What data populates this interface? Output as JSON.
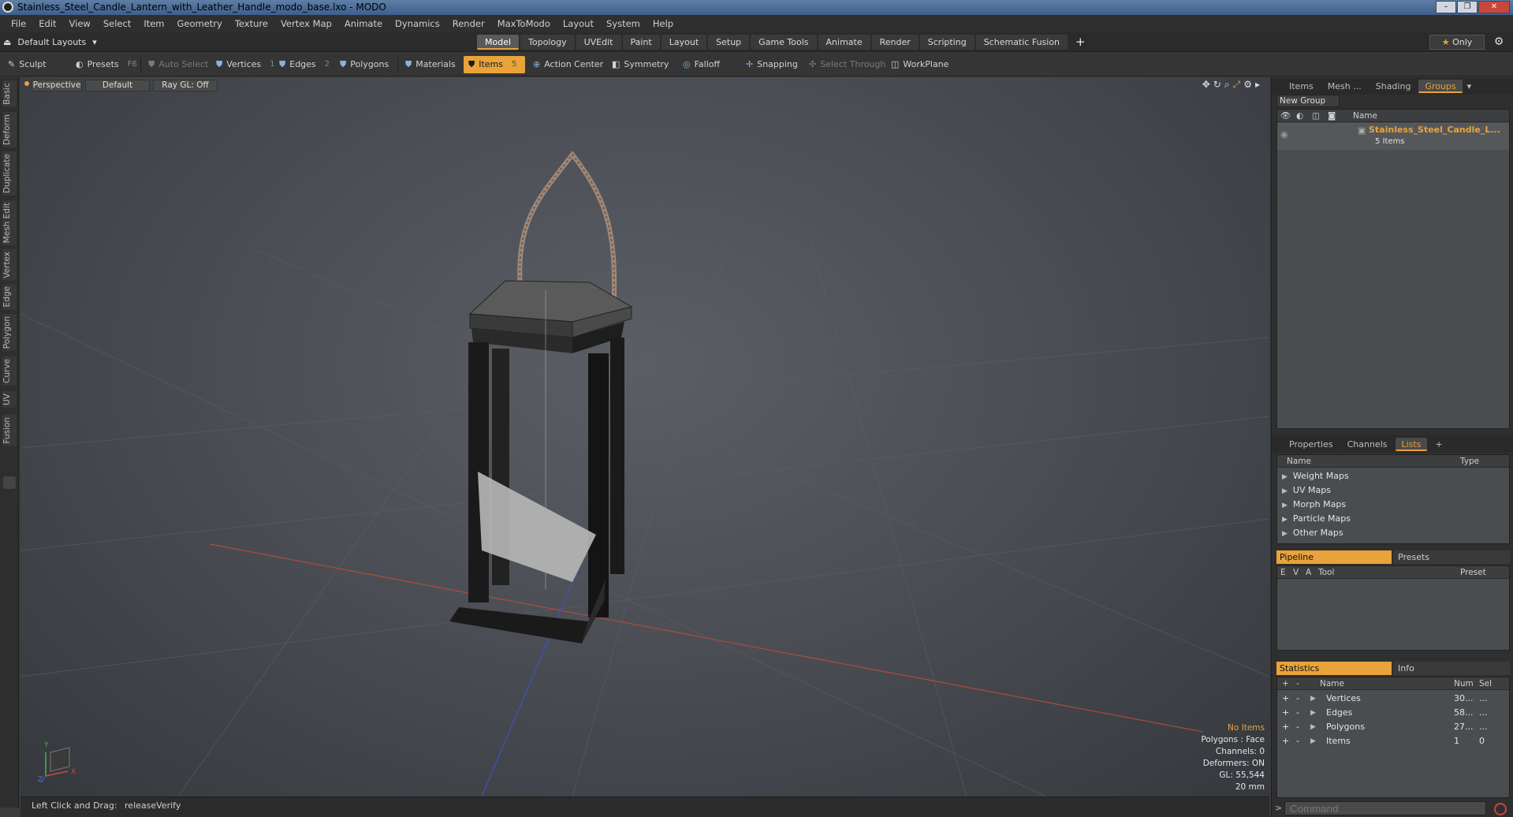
{
  "window": {
    "title": "Stainless_Steel_Candle_Lantern_with_Leather_Handle_modo_base.lxo - MODO",
    "buttons": [
      "–",
      "❐",
      "✕"
    ]
  },
  "menu": [
    "File",
    "Edit",
    "View",
    "Select",
    "Item",
    "Geometry",
    "Texture",
    "Vertex Map",
    "Animate",
    "Dynamics",
    "Render",
    "MaxToModo",
    "Layout",
    "System",
    "Help"
  ],
  "layouts": {
    "selector": "Default Layouts",
    "tabs": [
      "Model",
      "Topology",
      "UVEdit",
      "Paint",
      "Layout",
      "Setup",
      "Game Tools",
      "Animate",
      "Render",
      "Scripting",
      "Schematic Fusion"
    ],
    "active_tab": "Model",
    "plus": "+",
    "only_label": "Only"
  },
  "toolbar": {
    "sculpt": "Sculpt",
    "presets": "Presets",
    "presets_hint": "F6",
    "auto_select": "Auto Select",
    "vertices": "Vertices",
    "vertices_count": "1",
    "edges": "Edges",
    "edges_count": "2",
    "polygons": "Polygons",
    "materials": "Materials",
    "items": "Items",
    "items_count": "5",
    "action_center": "Action Center",
    "symmetry": "Symmetry",
    "falloff": "Falloff",
    "snapping": "Snapping",
    "select_through": "Select Through",
    "workplane": "WorkPlane"
  },
  "left_tabs": [
    "Basic",
    "Deform",
    "Duplicate",
    "Mesh Edit",
    "Vertex",
    "Edge",
    "Polygon",
    "Curve",
    "UV",
    "Fusion"
  ],
  "viewport": {
    "view": "Perspective",
    "shading": "Default",
    "raygl": "Ray GL: Off",
    "info": {
      "selection": "No Items",
      "polygons": "Polygons : Face",
      "channels": "Channels: 0",
      "deformers": "Deformers: ON",
      "gl": "GL: 55,544",
      "scale": "20 mm"
    },
    "axis": {
      "x": "X",
      "y": "Y",
      "z": "Z"
    }
  },
  "status": {
    "text": "Left Click and Drag:",
    "action": "releaseVerify"
  },
  "groups_panel": {
    "tabs": [
      "Items",
      "Mesh ...",
      "Shading",
      "Groups"
    ],
    "active_tab": "Groups",
    "new_group": "New Group",
    "column_name": "Name",
    "group_name": "Stainless_Steel_Candle_L...",
    "group_count": "5 Items"
  },
  "lists_panel": {
    "tabs": [
      "Properties",
      "Channels",
      "Lists"
    ],
    "active_tab": "Lists",
    "plus": "+",
    "col_name": "Name",
    "col_type": "Type",
    "items": [
      "Weight Maps",
      "UV Maps",
      "Morph Maps",
      "Particle Maps",
      "Other Maps"
    ]
  },
  "pipeline_panel": {
    "tab_active": "Pipeline",
    "tab_other": "Presets",
    "cols": [
      "E",
      "V",
      "A",
      "Tool",
      "Preset"
    ]
  },
  "stats_panel": {
    "tab_active": "Statistics",
    "tab_other": "Info",
    "cols": {
      "name": "Name",
      "num": "Num",
      "sel": "Sel"
    },
    "rows": [
      {
        "name": "Vertices",
        "num": "30...",
        "sel": "..."
      },
      {
        "name": "Edges",
        "num": "58...",
        "sel": "..."
      },
      {
        "name": "Polygons",
        "num": "27...",
        "sel": "..."
      },
      {
        "name": "Items",
        "num": "1",
        "sel": "0"
      }
    ]
  },
  "command": {
    "placeholder": "Command"
  },
  "colors": {
    "accent": "#e8a33a",
    "viewport_bg": "#4b4f55"
  }
}
